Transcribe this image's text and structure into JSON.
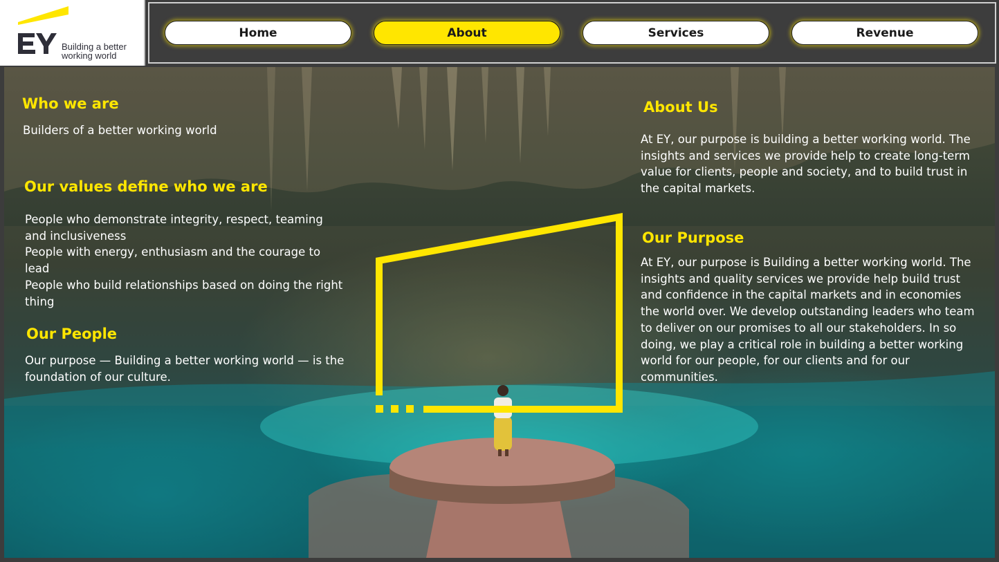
{
  "logo": {
    "brand": "EY",
    "tagline_line1": "Building a better",
    "tagline_line2": "working world",
    "brand_color": "#2e2e38",
    "beam_color": "#ffe600"
  },
  "nav": {
    "items": [
      {
        "label": "Home",
        "active": false
      },
      {
        "label": "About",
        "active": true
      },
      {
        "label": "Services",
        "active": false
      },
      {
        "label": "Revenue",
        "active": false
      }
    ],
    "active_color": "#ffe600"
  },
  "left": {
    "who_we_are": {
      "heading": "Who we are",
      "text": "Builders of a better working world"
    },
    "values": {
      "heading": "Our values define who we are",
      "lines": [
        "People who demonstrate integrity, respect, teaming and inclusiveness",
        "People with energy, enthusiasm and the courage to lead",
        "People who build relationships based on doing the right thing"
      ]
    },
    "people": {
      "heading": "Our People",
      "text": "Our purpose — Building a better working world — is the foundation of our culture."
    }
  },
  "right": {
    "about_us": {
      "heading": "About Us",
      "text": "At EY, our purpose is building a better working world. The insights and services we provide help to create long-term value for clients, people and society, and to build trust in the capital markets."
    },
    "purpose": {
      "heading": "Our Purpose",
      "text": "At EY, our purpose is Building a better working world. The insights and quality services we provide help build trust and confidence in the capital markets and in economies the world over. We develop outstanding leaders who team to deliver on our promises to all our stakeholders. In so doing, we play a critical role in building a better working world for our people, for our clients and for our communities."
    }
  },
  "colors": {
    "heading": "#ffe600",
    "body_text": "#ffffff",
    "water": "#1ec8c0"
  }
}
